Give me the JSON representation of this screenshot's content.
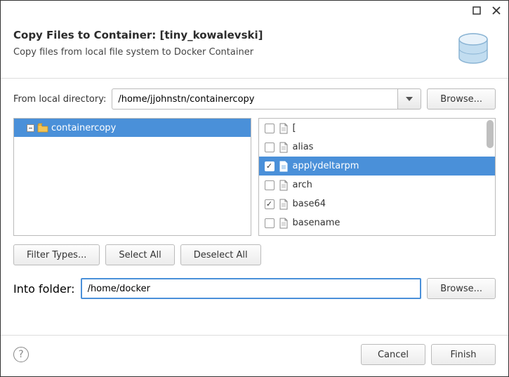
{
  "header": {
    "title": "Copy Files to Container: [tiny_kowalevski]",
    "subtitle": "Copy files from local file system to Docker Container"
  },
  "from": {
    "label": "From local directory:",
    "value": "/home/jjohnstn/containercopy",
    "browse": "Browse..."
  },
  "tree": {
    "root": "containercopy"
  },
  "files": [
    {
      "name": "[",
      "checked": false,
      "selected": false
    },
    {
      "name": "alias",
      "checked": false,
      "selected": false
    },
    {
      "name": "applydeltarpm",
      "checked": true,
      "selected": true
    },
    {
      "name": "arch",
      "checked": false,
      "selected": false
    },
    {
      "name": "base64",
      "checked": true,
      "selected": false
    },
    {
      "name": "basename",
      "checked": false,
      "selected": false
    }
  ],
  "buttons": {
    "filter": "Filter Types...",
    "select_all": "Select All",
    "deselect_all": "Deselect All"
  },
  "into": {
    "label": "Into folder:",
    "value": "/home/docker",
    "browse": "Browse..."
  },
  "footer": {
    "cancel": "Cancel",
    "finish": "Finish"
  }
}
